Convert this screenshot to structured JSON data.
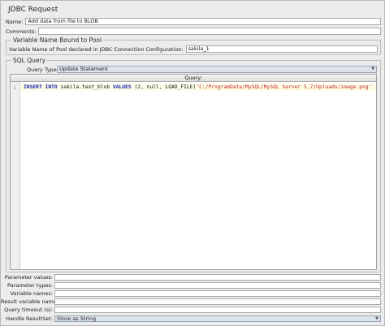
{
  "panel": {
    "title": "JDBC Request"
  },
  "name_field": {
    "label": "Name:",
    "value": "Add data from file to BLOB"
  },
  "comments_field": {
    "label": "Comments:",
    "value": ""
  },
  "pool_group": {
    "legend": "Variable Name Bound to Pool",
    "label": "Variable Name of Pool declared in JDBC Connection Configuration:",
    "value": "sakila_1"
  },
  "sql_group": {
    "legend": "SQL Query",
    "query_type_label": "Query Type:",
    "query_type_value": "Update Statement",
    "editor_header": "Query:",
    "line_number": "1",
    "code": {
      "kw1": "INSERT INTO",
      "t1": " sakila.test_blob ",
      "kw2": "VALUES",
      "t2": " (2, null, LOAD_FILE(",
      "s1": "'C:/ProgramData/MySQL/MySQL Server 5.7/Uploads/image.png'",
      "t3": "));"
    }
  },
  "params": [
    {
      "label": "Parameter values:",
      "value": ""
    },
    {
      "label": "Parameter types:",
      "value": ""
    },
    {
      "label": "Variable names:",
      "value": ""
    },
    {
      "label": "Result variable name:",
      "value": ""
    },
    {
      "label": "Query timeout (s):",
      "value": ""
    }
  ],
  "result_set": {
    "label": "Handle ResultSet:",
    "value": "Store as String"
  }
}
